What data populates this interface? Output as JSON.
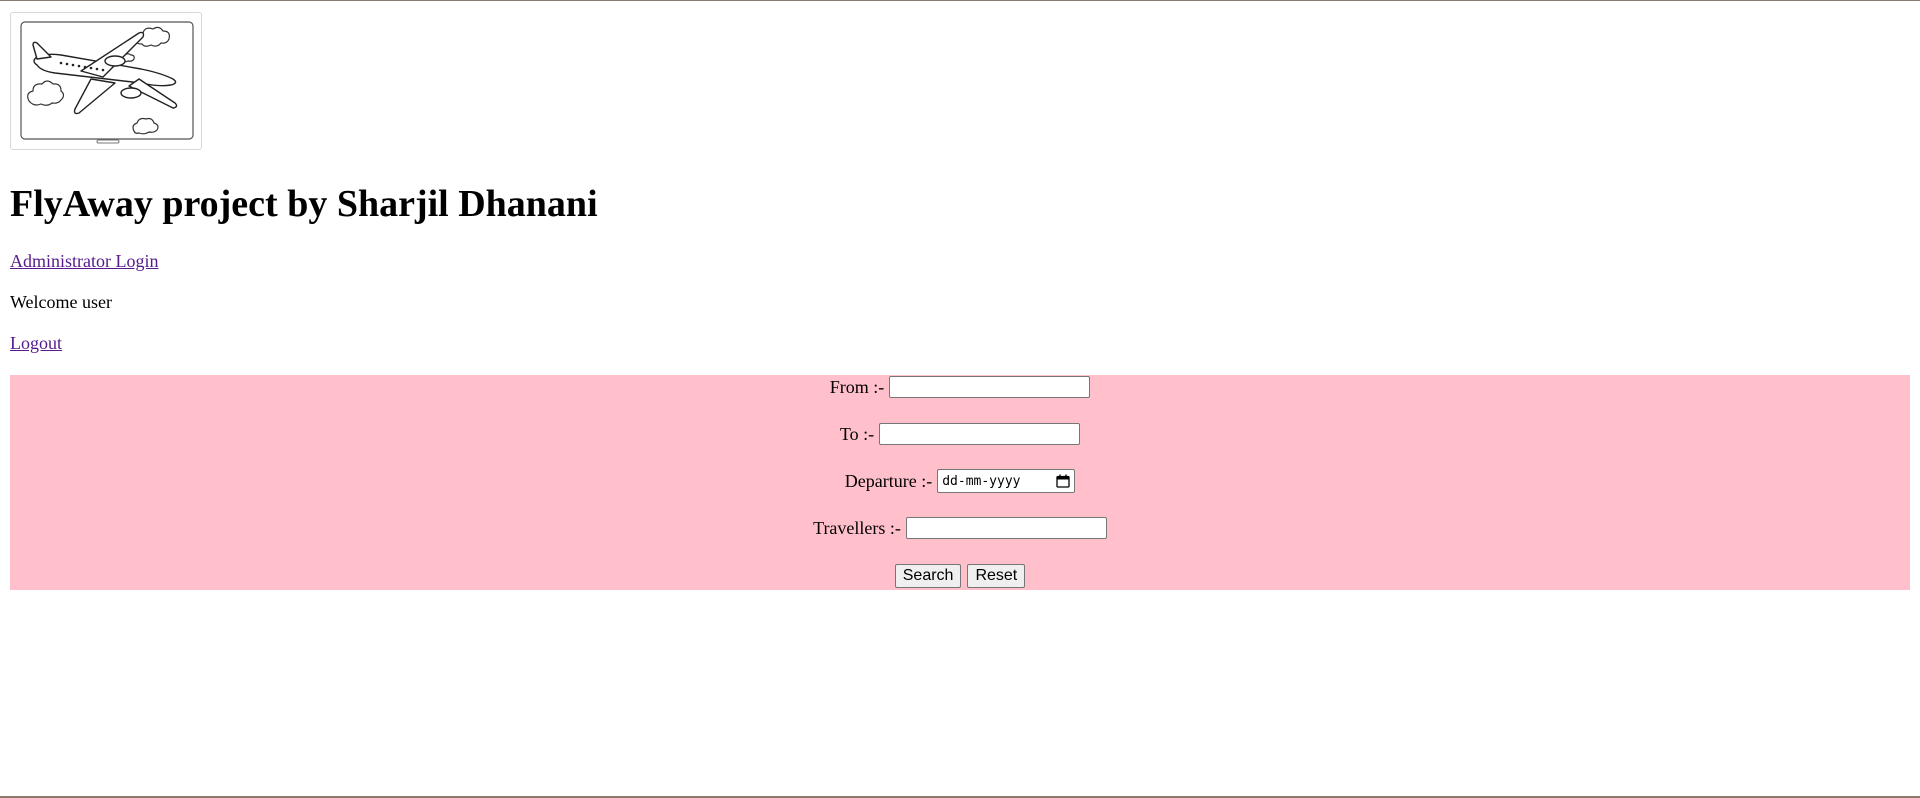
{
  "header": {
    "logo_icon": "airplane-with-clouds-icon",
    "title": "FlyAway project by Sharjil Dhanani"
  },
  "nav": {
    "admin_login": "Administrator Login",
    "welcome_text": "Welcome user",
    "logout": "Logout"
  },
  "search_form": {
    "background_color": "#ffc0cb",
    "from_label": "From :-",
    "from_value": "",
    "to_label": "To :-",
    "to_value": "",
    "departure_label": "Departure :-",
    "departure_placeholder": "dd-mm-yyyy",
    "departure_icon": "calendar-icon",
    "travellers_label": "Travellers :-",
    "travellers_value": "",
    "search_button": "Search",
    "reset_button": "Reset"
  }
}
